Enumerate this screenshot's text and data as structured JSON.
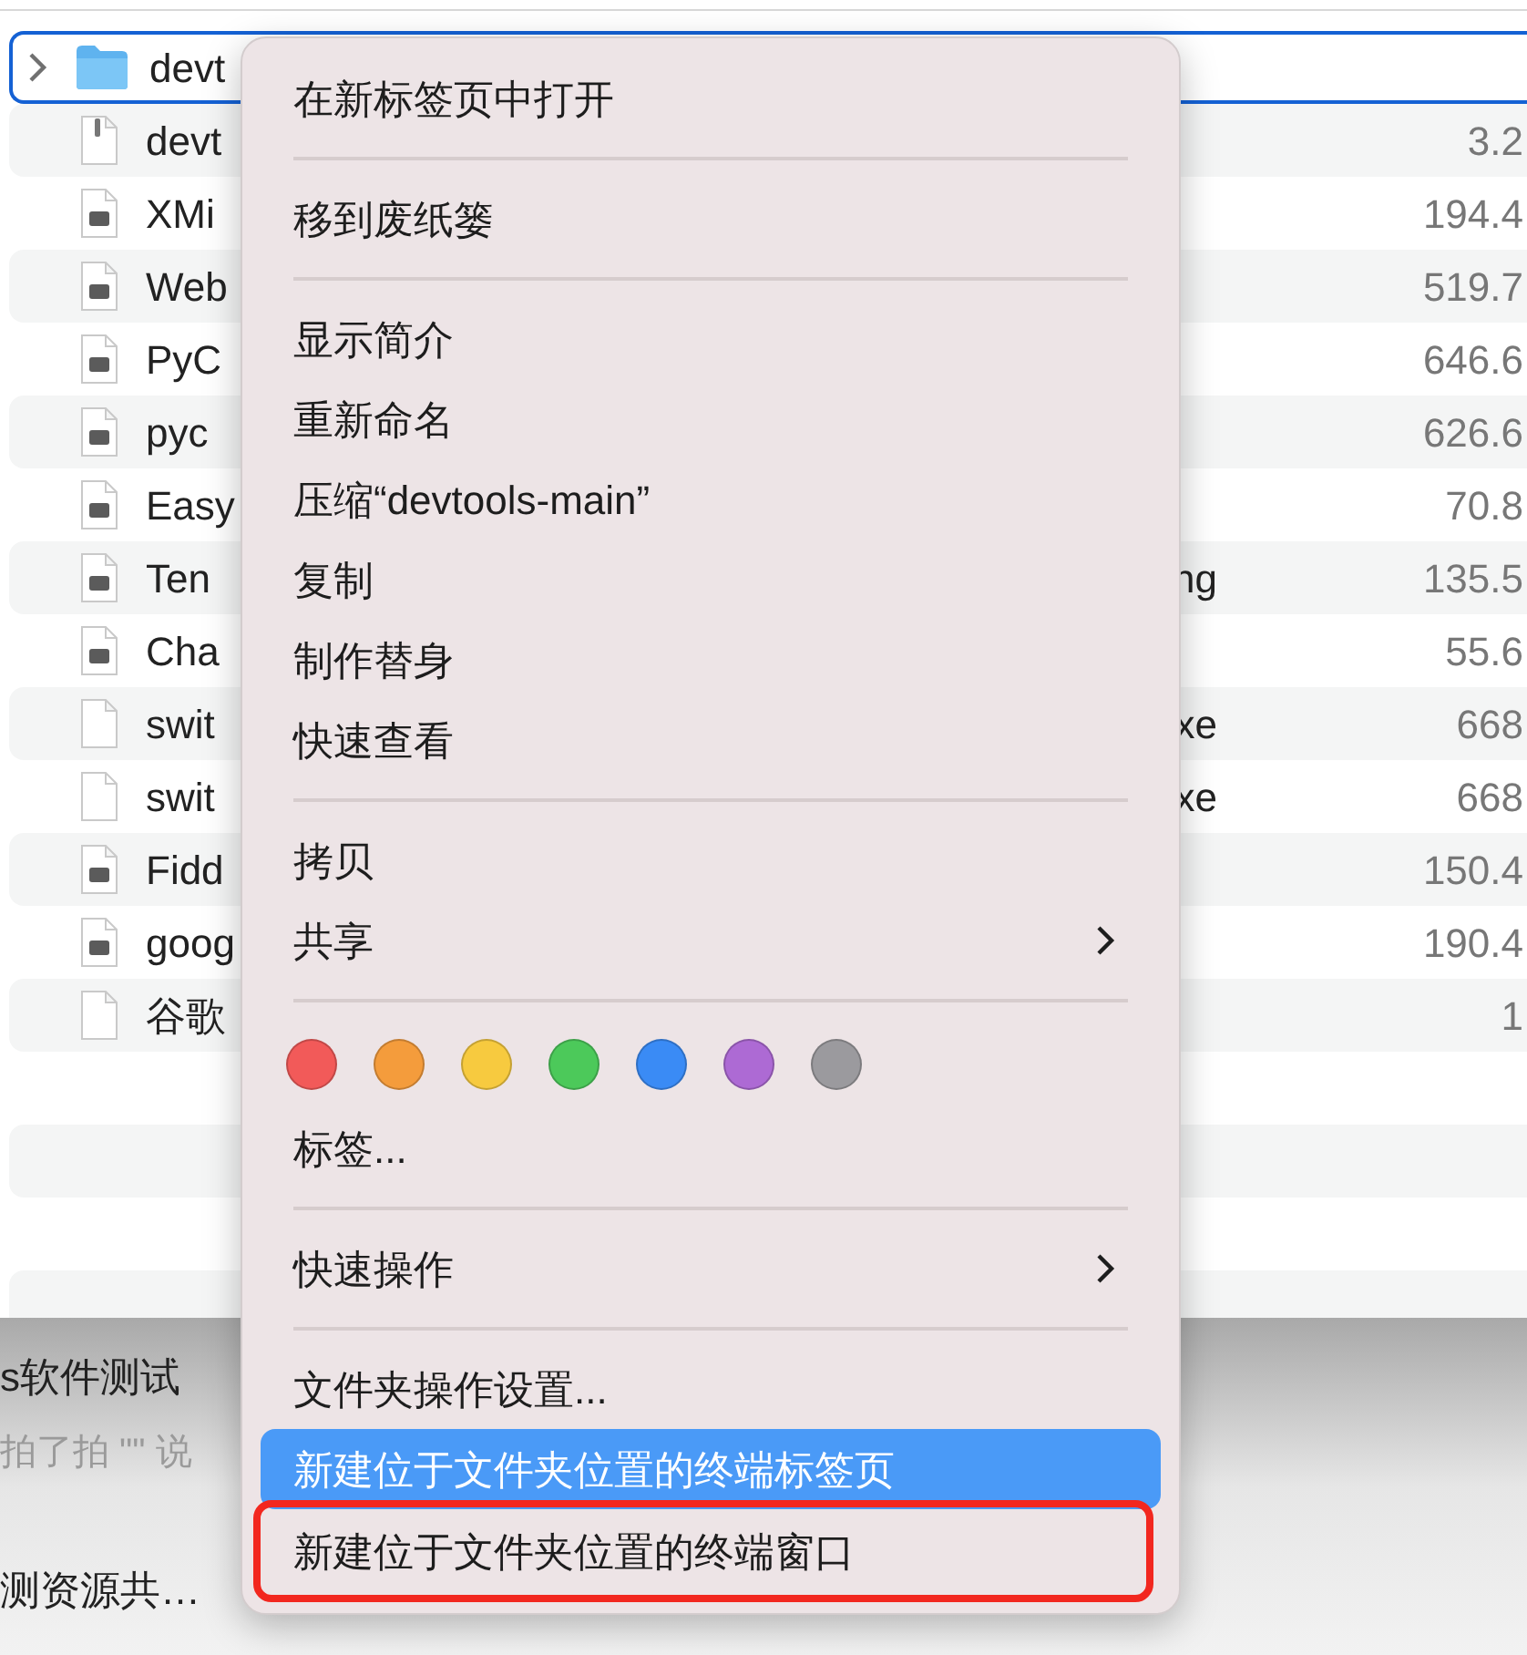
{
  "file_list": {
    "rows": [
      {
        "kind": "folder",
        "name": "devt",
        "extension": "",
        "size": "",
        "selected": true
      },
      {
        "kind": "zip",
        "name": "devt",
        "extension": "",
        "size": "3.2",
        "selected": false
      },
      {
        "kind": "app",
        "name": "XMi",
        "extension": "",
        "size": "194.4",
        "selected": false
      },
      {
        "kind": "app",
        "name": "Web",
        "extension": "",
        "size": "519.7",
        "selected": false
      },
      {
        "kind": "app",
        "name": "PyC",
        "extension": "",
        "size": "646.6",
        "selected": false
      },
      {
        "kind": "app",
        "name": "pyc",
        "extension": "",
        "size": "626.6",
        "selected": false
      },
      {
        "kind": "app",
        "name": "Easy",
        "extension": "",
        "size": "70.8",
        "selected": false
      },
      {
        "kind": "app",
        "name": "Ten",
        "extension": "ng",
        "size": "135.5",
        "selected": false
      },
      {
        "kind": "app",
        "name": "Cha",
        "extension": "",
        "size": "55.6",
        "selected": false
      },
      {
        "kind": "blank",
        "name": "swit",
        "extension": "xe",
        "size": "668",
        "selected": false
      },
      {
        "kind": "blank",
        "name": "swit",
        "extension": "xe",
        "size": "668",
        "selected": false
      },
      {
        "kind": "app",
        "name": "Fidd",
        "extension": "",
        "size": "150.4",
        "selected": false
      },
      {
        "kind": "app",
        "name": "goog",
        "extension": "",
        "size": "190.4",
        "selected": false
      },
      {
        "kind": "blank",
        "name": "谷歌",
        "extension": "",
        "size": "1",
        "selected": false
      }
    ]
  },
  "chat_list": {
    "items": [
      {
        "title": "s软件测试",
        "preview": "拍了拍 \"\" 说"
      },
      {
        "title": "测资源共…"
      }
    ]
  },
  "context_menu": {
    "items": [
      {
        "kind": "item",
        "label": "在新标签页中打开",
        "submenu": false,
        "selected": false,
        "outlined": false
      },
      {
        "kind": "separator"
      },
      {
        "kind": "item",
        "label": "移到废纸篓",
        "submenu": false,
        "selected": false,
        "outlined": false
      },
      {
        "kind": "separator"
      },
      {
        "kind": "item",
        "label": "显示简介",
        "submenu": false,
        "selected": false,
        "outlined": false
      },
      {
        "kind": "item",
        "label": "重新命名",
        "submenu": false,
        "selected": false,
        "outlined": false
      },
      {
        "kind": "item",
        "label": "压缩“devtools-main”",
        "submenu": false,
        "selected": false,
        "outlined": false
      },
      {
        "kind": "item",
        "label": "复制",
        "submenu": false,
        "selected": false,
        "outlined": false
      },
      {
        "kind": "item",
        "label": "制作替身",
        "submenu": false,
        "selected": false,
        "outlined": false
      },
      {
        "kind": "item",
        "label": "快速查看",
        "submenu": false,
        "selected": false,
        "outlined": false
      },
      {
        "kind": "separator"
      },
      {
        "kind": "item",
        "label": "拷贝",
        "submenu": false,
        "selected": false,
        "outlined": false
      },
      {
        "kind": "item",
        "label": "共享",
        "submenu": true,
        "selected": false,
        "outlined": false
      },
      {
        "kind": "separator"
      },
      {
        "kind": "tags",
        "tags": [
          {
            "color": "#f25a59"
          },
          {
            "color": "#f49c3c"
          },
          {
            "color": "#f7ca3f"
          },
          {
            "color": "#4cc95a"
          },
          {
            "color": "#3a8bf5"
          },
          {
            "color": "#ad6ad4"
          },
          {
            "color": "#9b9a9e"
          }
        ]
      },
      {
        "kind": "item",
        "label": "标签...",
        "submenu": false,
        "selected": false,
        "outlined": false
      },
      {
        "kind": "separator"
      },
      {
        "kind": "item",
        "label": "快速操作",
        "submenu": true,
        "selected": false,
        "outlined": false
      },
      {
        "kind": "separator"
      },
      {
        "kind": "item",
        "label": "文件夹操作设置...",
        "submenu": false,
        "selected": false,
        "outlined": false
      },
      {
        "kind": "item",
        "label": "新建位于文件夹位置的终端标签页",
        "submenu": false,
        "selected": true,
        "outlined": false
      },
      {
        "kind": "item",
        "label": "新建位于文件夹位置的终端窗口",
        "submenu": false,
        "selected": false,
        "outlined": true
      }
    ]
  }
}
